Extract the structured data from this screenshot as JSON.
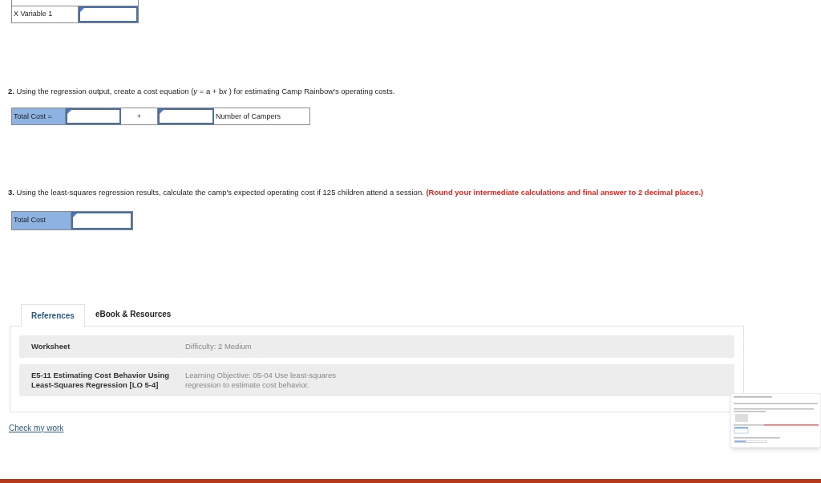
{
  "regression_table": {
    "rows": [
      {
        "label": "X Variable 1"
      }
    ]
  },
  "question_2": {
    "number": "2.",
    "text_parts": [
      {
        "text": "Using the regression output, create a cost equation (",
        "italic": false
      },
      {
        "text": "y",
        "italic": true
      },
      {
        "text": " = a + b",
        "italic": false
      },
      {
        "text": "x",
        "italic": true
      },
      {
        "text": " ) for estimating Camp Rainbow's operating costs.",
        "italic": false
      }
    ],
    "equation": {
      "label": "Total Cost =",
      "operator": "+",
      "variable": "Number of Campers"
    }
  },
  "question_3": {
    "number": "3.",
    "text": "Using the least-squares regression results, calculate the camp's expected operating cost if 125 children attend a session.",
    "instruction": "(Round your intermediate calculations and final answer to 2 decimal places.)",
    "answer": {
      "label": "Total Cost"
    }
  },
  "tabs": [
    {
      "label": "References",
      "selected": true
    },
    {
      "label": "eBook & Resources",
      "selected": false
    }
  ],
  "references": [
    {
      "title": "Worksheet",
      "detail": "Difficulty: 2 Medium"
    },
    {
      "title": "E5-11 Estimating Cost Behavior Using Least-Squares Regression [LO 5-4]",
      "detail": "Learning Objective: 05-04 Use least-squares regression to estimate cost behavior."
    }
  ],
  "check_link": "Check my work"
}
